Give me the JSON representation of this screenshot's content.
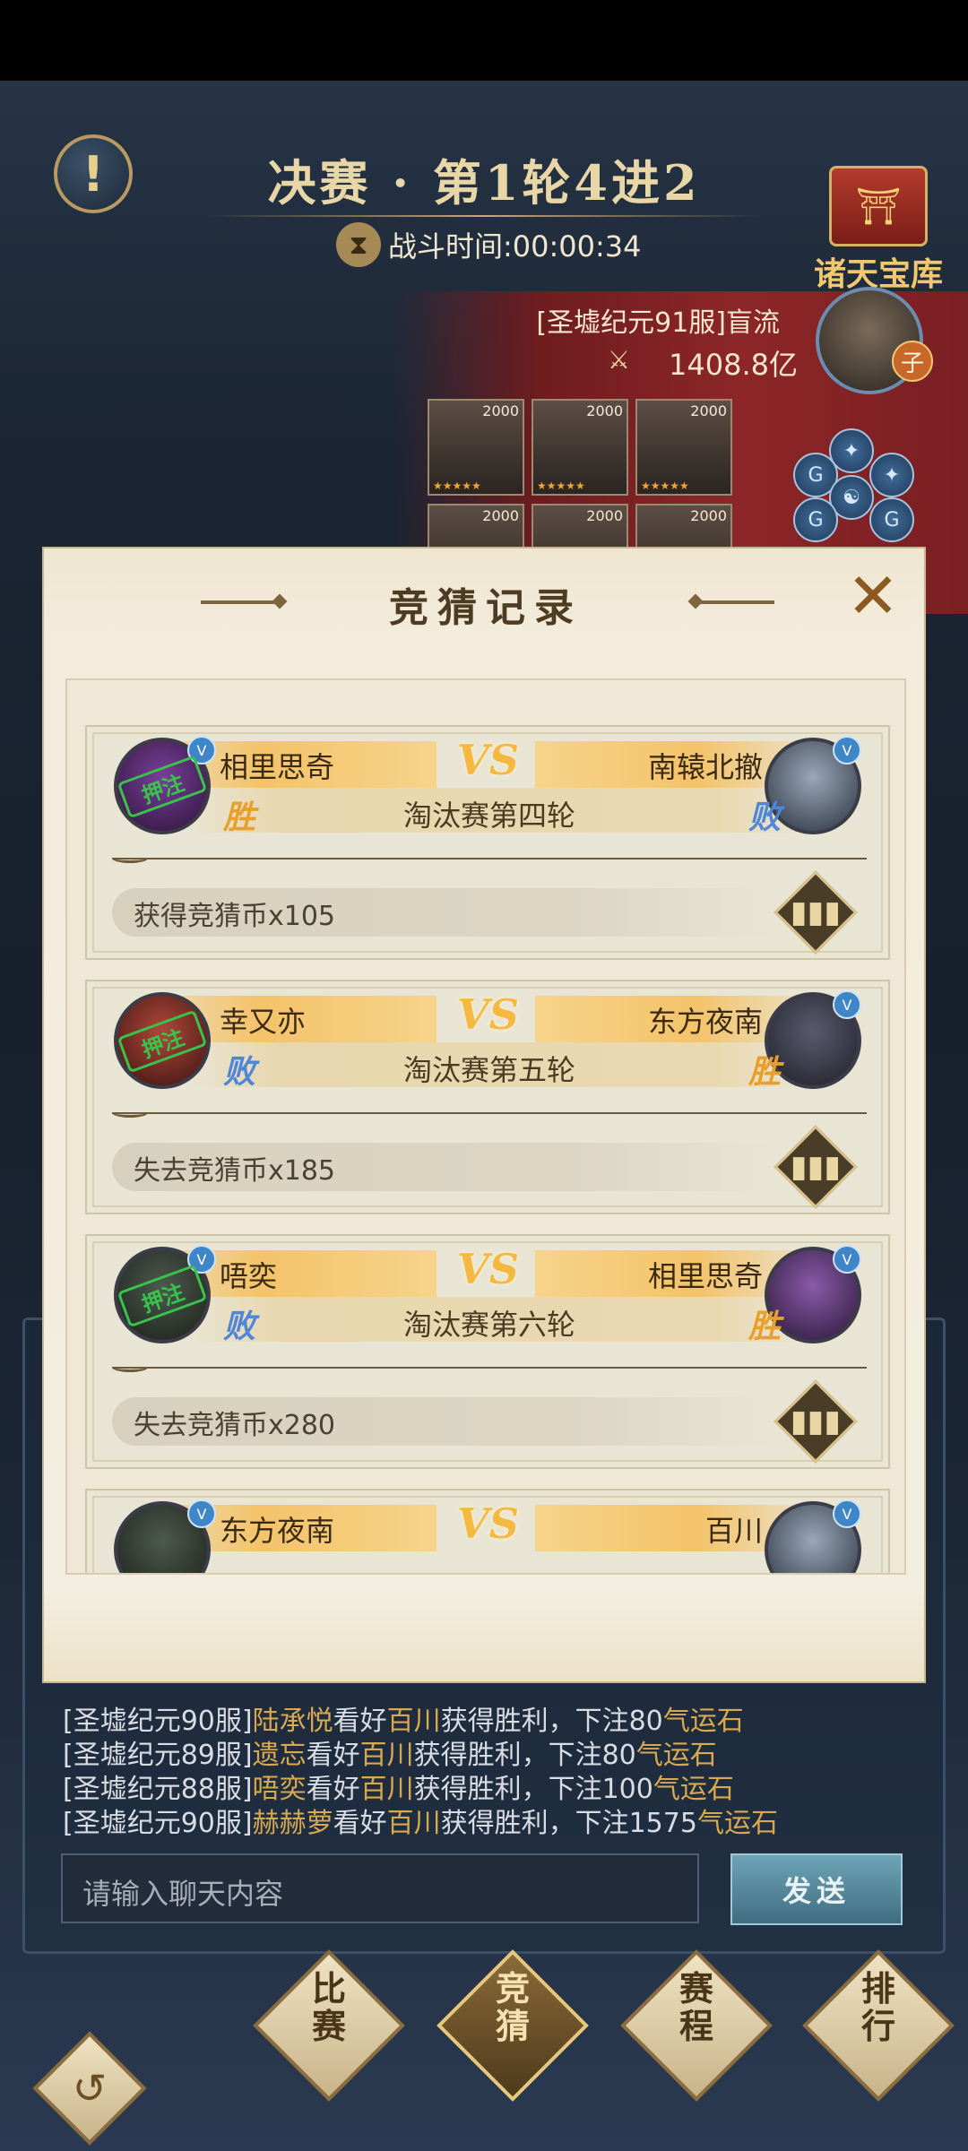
{
  "header": {
    "title": "决赛 · 第1轮4进2",
    "timer_label": "战斗时间:00:00:34",
    "treasure_label": "诸天宝库",
    "info_icon": "exclamation-icon"
  },
  "player": {
    "name": "[圣墟纪元91服]盲流",
    "power": "1408.8亿",
    "badge": "子",
    "heroes": [
      "2000",
      "2000",
      "2000",
      "2000",
      "2000",
      "2000"
    ]
  },
  "dialog": {
    "title": "竞猜记录",
    "close_icon": "close-icon",
    "records": [
      {
        "left_name": "相里思奇",
        "right_name": "南辕北撤",
        "round": "淘汰赛第四轮",
        "left_result": "胜",
        "right_result": "败",
        "coins": "获得竞猜币x105",
        "stamp": "押注",
        "stamp_side": "left"
      },
      {
        "left_name": "幸又亦",
        "right_name": "东方夜南",
        "round": "淘汰赛第五轮",
        "left_result": "败",
        "right_result": "胜",
        "coins": "失去竞猜币x185",
        "stamp": "押注",
        "stamp_side": "left"
      },
      {
        "left_name": "唔奕",
        "right_name": "相里思奇",
        "round": "淘汰赛第六轮",
        "left_result": "败",
        "right_result": "胜",
        "coins": "失去竞猜币x280",
        "stamp": "押注",
        "stamp_side": "left"
      },
      {
        "left_name": "东方夜南",
        "right_name": "百川",
        "round": "",
        "left_result": "",
        "right_result": "",
        "coins": "",
        "stamp": "",
        "stamp_side": ""
      }
    ],
    "vs_label": "VS"
  },
  "chat": {
    "lines": [
      {
        "server": "[圣墟纪元90服]",
        "user": "陆承悦",
        "mid": "看好",
        "pick": "百川",
        "tail": "获得胜利，下注80",
        "item": "气运石"
      },
      {
        "server": "[圣墟纪元89服]",
        "user": "遗忘",
        "mid": "看好",
        "pick": "百川",
        "tail": "获得胜利，下注80",
        "item": "气运石"
      },
      {
        "server": "[圣墟纪元88服]",
        "user": "唔奕",
        "mid": "看好",
        "pick": "百川",
        "tail": "获得胜利，下注100",
        "item": "气运石"
      },
      {
        "server": "[圣墟纪元90服]",
        "user": "赫赫萝",
        "mid": "看好",
        "pick": "百川",
        "tail": "获得胜利，下注1575",
        "item": "气运石"
      }
    ],
    "input_placeholder": "请输入聊天内容",
    "send_label": "发送"
  },
  "nav": {
    "items": [
      {
        "top": "比",
        "bottom": "赛",
        "active": false
      },
      {
        "top": "竞",
        "bottom": "猜",
        "active": true
      },
      {
        "top": "赛",
        "bottom": "程",
        "active": false
      },
      {
        "top": "排",
        "bottom": "行",
        "active": false
      }
    ]
  },
  "colors": {
    "win": "#e8a02c",
    "lose": "#4f86d8",
    "highlight": "#d9a94f"
  }
}
